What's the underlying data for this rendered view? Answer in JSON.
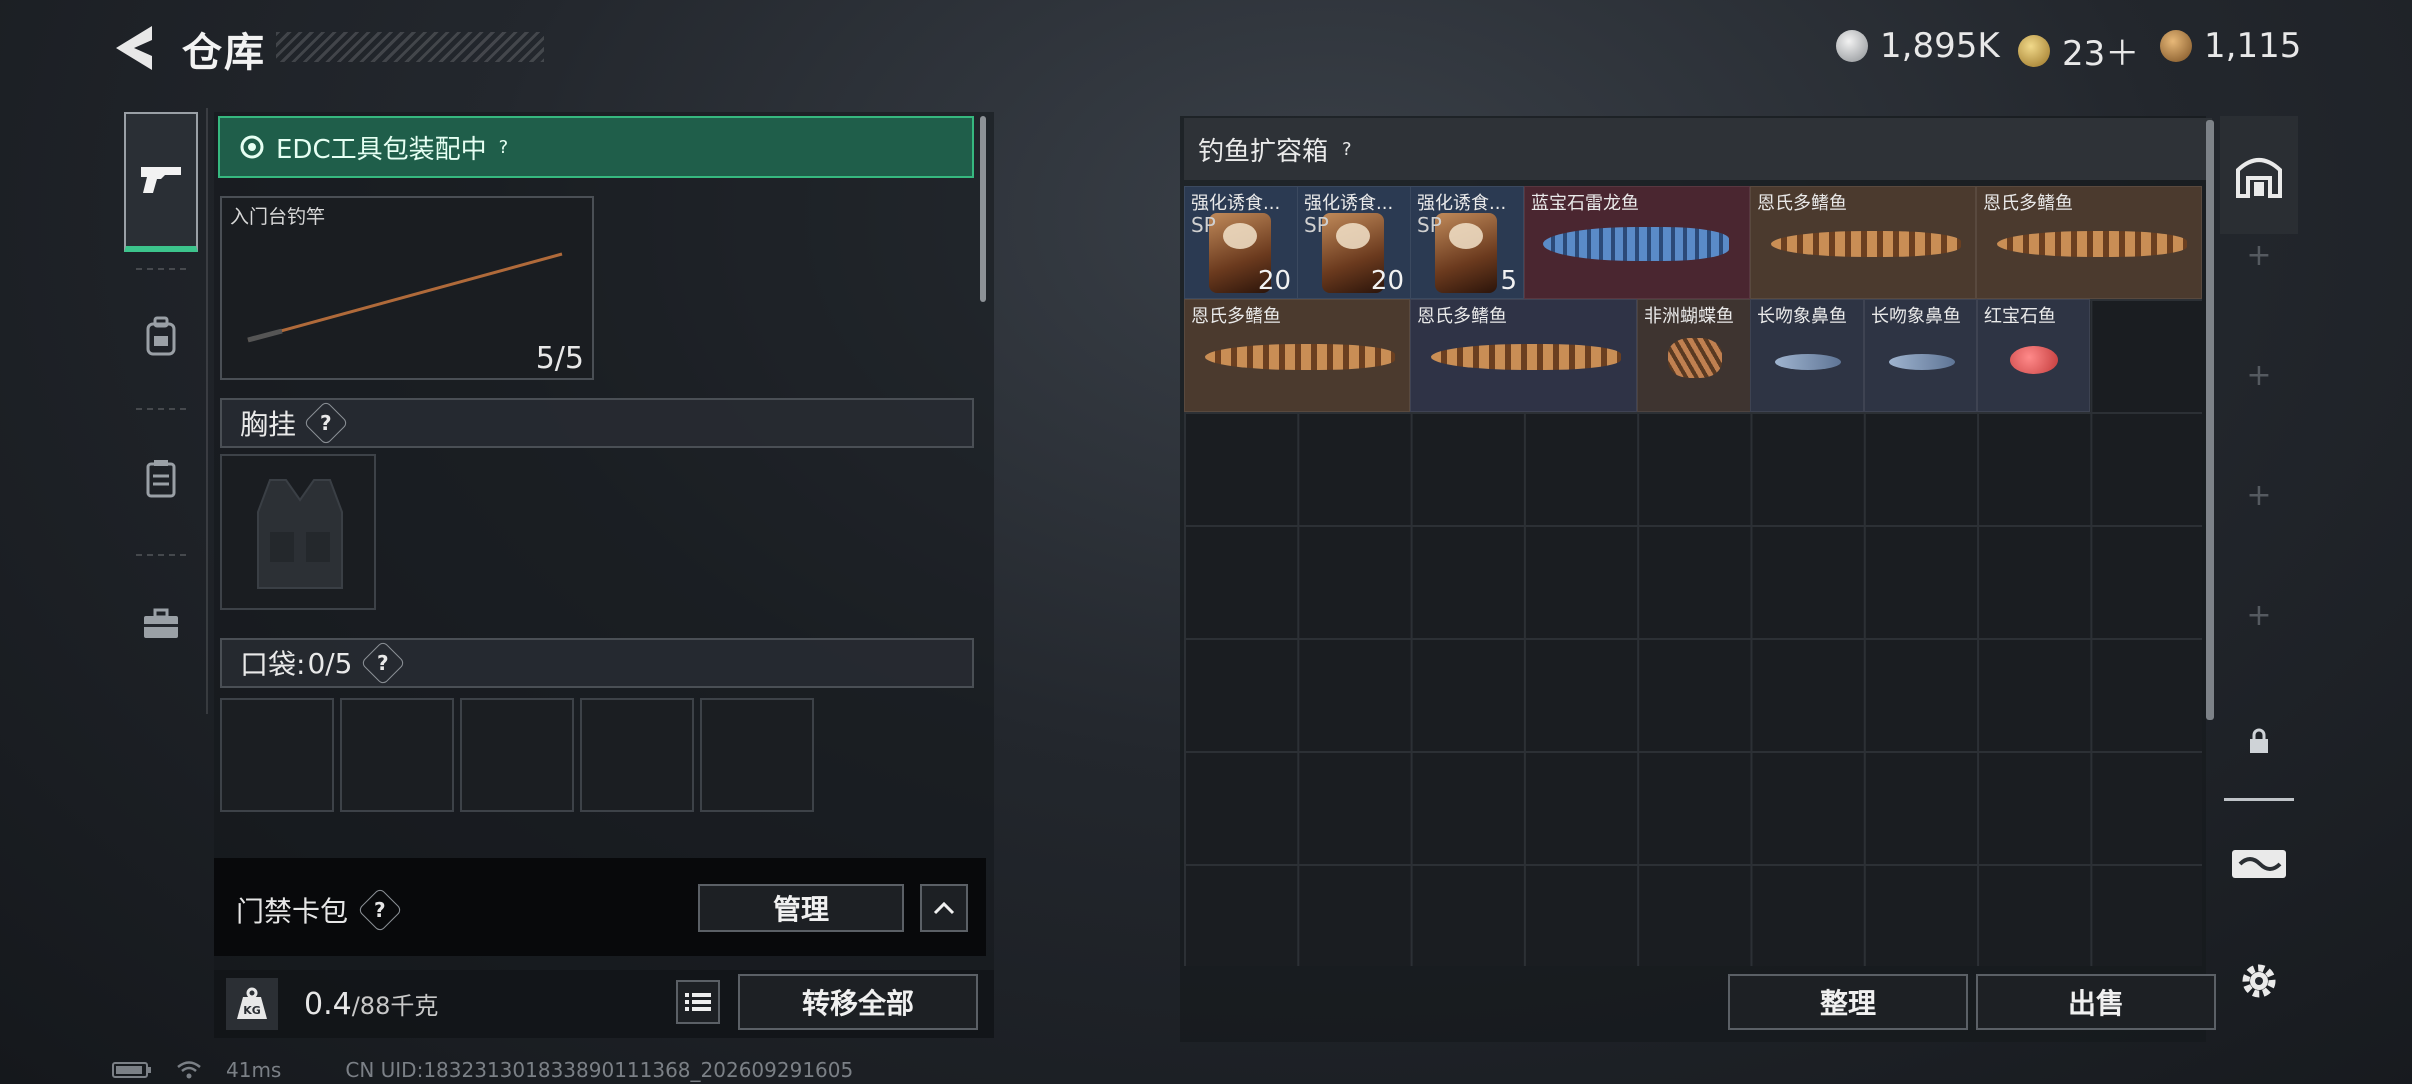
{
  "header": {
    "title": "仓库",
    "currencies": [
      {
        "icon": "silver-coin-icon",
        "value": "1,895K",
        "color": "#b8bcc0"
      },
      {
        "icon": "gold-triangle-coin-icon",
        "value": "23＋",
        "color": "#c9a14a"
      },
      {
        "icon": "bronze-coin-icon",
        "value": "1,115",
        "color": "#b98a4a"
      }
    ]
  },
  "sidebar": {
    "tabs": [
      {
        "name": "pistol-icon"
      },
      {
        "name": "backpack-icon"
      },
      {
        "name": "vest-icon"
      },
      {
        "name": "toolbox-icon"
      }
    ]
  },
  "left": {
    "edc_status": "EDC工具包装配中",
    "rod": {
      "label": "入门台钓竿",
      "count": "5/5"
    },
    "chest_rig_label": "胸挂",
    "pocket_label": "口袋:",
    "pocket_count": "0/5",
    "keycard_label": "门禁卡包",
    "manage_label": "管理",
    "weight_value": "0.4",
    "weight_max": "/88千克",
    "transfer_all_label": "转移全部"
  },
  "right": {
    "box_title": "钓鱼扩容箱",
    "items": [
      {
        "name": "强化诱食...",
        "sub": "SP",
        "count": "20"
      },
      {
        "name": "强化诱食...",
        "sub": "SP",
        "count": "20"
      },
      {
        "name": "强化诱食...",
        "sub": "SP",
        "count": "5"
      },
      {
        "name": "蓝宝石雷龙鱼"
      },
      {
        "name": "恩氏多鳍鱼"
      },
      {
        "name": "恩氏多鳍鱼"
      },
      {
        "name": "恩氏多鳍鱼"
      },
      {
        "name": "恩氏多鳍鱼"
      },
      {
        "name": "非洲蝴蝶鱼"
      },
      {
        "name": "长吻象鼻鱼"
      },
      {
        "name": "长吻象鼻鱼"
      },
      {
        "name": "红宝石鱼"
      }
    ],
    "sort_label": "整理",
    "sell_label": "出售"
  },
  "status": {
    "ping": "41ms",
    "uid": "CN UID:18323130183389011136​8_202609291605"
  }
}
